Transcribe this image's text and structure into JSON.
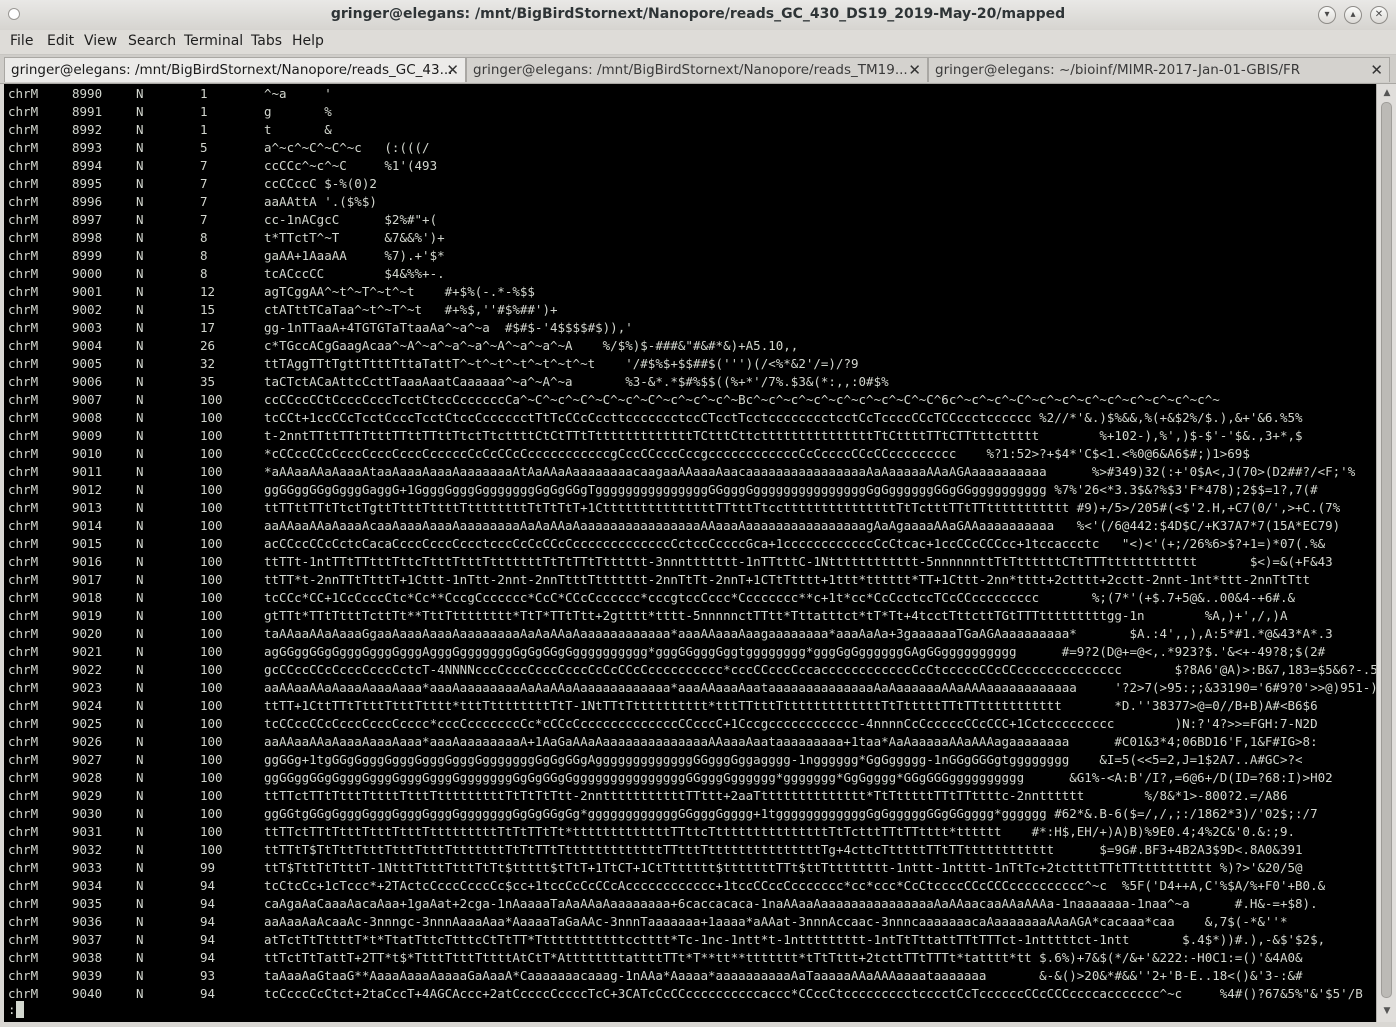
{
  "window": {
    "title": "gringer@elegans: /mnt/BigBirdStornext/Nanopore/reads_GC_430_DS19_2019-May-20/mapped"
  },
  "menu": [
    "File",
    "Edit",
    "View",
    "Search",
    "Terminal",
    "Tabs",
    "Help"
  ],
  "tabs": [
    {
      "label": "gringer@elegans: /mnt/BigBirdStornext/Nanopore/reads_GC_43...",
      "close": "✕"
    },
    {
      "label": "gringer@elegans: /mnt/BigBirdStornext/Nanopore/reads_TM19...",
      "close": "✕"
    },
    {
      "label": "gringer@elegans: ~/bioinf/MIMR-2017-Jan-01-GBIS/FR",
      "close": "✕"
    }
  ],
  "terminal": {
    "prompt": ":",
    "rows": [
      [
        "chrM",
        "8990",
        "N",
        "1",
        "^~a     '"
      ],
      [
        "chrM",
        "8991",
        "N",
        "1",
        "g       %"
      ],
      [
        "chrM",
        "8992",
        "N",
        "1",
        "t       &"
      ],
      [
        "chrM",
        "8993",
        "N",
        "5",
        "a^~c^~C^~C^~c   (:(((/"
      ],
      [
        "chrM",
        "8994",
        "N",
        "7",
        "ccCCc^~c^~C     %1'(493"
      ],
      [
        "chrM",
        "8995",
        "N",
        "7",
        "ccCCccC $-%(0)2"
      ],
      [
        "chrM",
        "8996",
        "N",
        "7",
        "aaAAttA '.($%$)"
      ],
      [
        "chrM",
        "8997",
        "N",
        "7",
        "cc-1nACgcC      $2%#\"+("
      ],
      [
        "chrM",
        "8998",
        "N",
        "8",
        "t*TTctT^~T      &7&&%')+"
      ],
      [
        "chrM",
        "8999",
        "N",
        "8",
        "gaAA+1AaaAA     %7).+'$*"
      ],
      [
        "chrM",
        "9000",
        "N",
        "8",
        "tcACccCC        $4&%%+-."
      ],
      [
        "chrM",
        "9001",
        "N",
        "12",
        "agTCggAA^~t^~T^~t^~t    #+$%(-.*-%$$"
      ],
      [
        "chrM",
        "9002",
        "N",
        "15",
        "ctATttTCaTaa^~t^~T^~t   #+%$,''#$%##')+"
      ],
      [
        "chrM",
        "9003",
        "N",
        "17",
        "gg-1nTTaaA+4TGTGTaTtaaAa^~a^~a  #$#$-'4$$$$#$)),'"
      ],
      [
        "chrM",
        "9004",
        "N",
        "26",
        "c*TGccACgGaagAcaa^~A^~a^~a^~a^~A^~a^~a^~A    %/$%)$-###&\"#&#*&)+A5.10,,"
      ],
      [
        "chrM",
        "9005",
        "N",
        "32",
        "ttTAggTTtTgttTtttTttaTattT^~t^~t^~t^~t^~t^~t    '/#$%$+$$##$(''')(/<%*&2'/=)/?9"
      ],
      [
        "chrM",
        "9006",
        "N",
        "35",
        "taCTctACaAttcCcttTaaaAaatCaaaaaa^~a^~A^~a       %3-&*.*$#%$$((%+*'/7%.$3&(*:,,:0#$%"
      ],
      [
        "chrM",
        "9007",
        "N",
        "100",
        "ccCCccCCtCcccCcccTcctCtccCccccccCa^~C^~c^~C^~C^~c^~C^~c^~c^~c^~Bc^~c^~c^~c^~c^~c^~c^~C^~C^6c^~c^~c^~C^~c^~c^~c^~c^~c^~c^~c^~c^~"
      ],
      [
        "chrM",
        "9008",
        "N",
        "100",
        "tcCCt+1ccCCcTcctCcccTcctCtccCcccccctTtTcCCcCccttccccccctccCTcctTcctcccccccctcctCcTccccCCcTCCccctcccccc %2//*'&.)$%&&,%(+&$2%/$.),&+'&6.%5%"
      ],
      [
        "chrM",
        "9009",
        "N",
        "100",
        "t-2nntTTttTTtTtttTTttTTttTtctTtcttttCtCtTTtTtttttttttttttTCtttCttctttttttttttttttTtCttttTTtCTTtttcttttt        %+102-),%',)$-$'-'$&.,3+*,$"
      ],
      [
        "chrM",
        "9010",
        "N",
        "100",
        "*cCCccCCcCcccCcccCcccCcccccCcCcCCcCcccccccccccgCccCCcccCccgccccccccccccCcCccccCCcCCccccccccc    %?1:52>?+$4*'C$<1.<%0@6&A6$#;)1>69$"
      ],
      [
        "chrM",
        "9011",
        "N",
        "100",
        "*aAAaaAAaAaaaAtaaAaaaAaaaAaaaaaaaAtAaAAaAaaaaaaaacaagaaAAaaaAaacaaaaaaaaaaaaaaaaAaAaaaaaAAaAGAaaaaaaaaaa      %>#349)32(:+'0$A<,J(70>(D2##?/<F;'%"
      ],
      [
        "chrM",
        "9012",
        "N",
        "100",
        "ggGGggGGgGgggGaggG+1GgggGgggGgggggggGgGgGGgTgggggggggggggggGGgggGgggggggggggggggGgGggggggGGgGGgggggggggg %7%'26<*3.3$&?%$3'F*478);2$$=1?,7(#"
      ],
      [
        "chrM",
        "9013",
        "N",
        "100",
        "ttTTttTTtTtctTgttTtttTttttTttttttttTtTtTtT+1CtttttttttttttttTTtttTtcctttttttttttttttTtTctttTTtTTttttttttttt #9)+/5>/205#(<$'2.H,+C7(0/',>+C.(7%"
      ],
      [
        "chrM",
        "9014",
        "N",
        "100",
        "aaAAaaAAaAaaaAcaaAaaaAaaaAaaaaaaaaAaAaAAaAaaaaaaaaaaaaaaaaAAaaaAaaaaaaaaaaaaaaaagAaAgaaaaAAaGAAaaaaaaaaaa   %<'(/6@442:$4D$C/+K37A7*7(15A*EC79)"
      ],
      [
        "chrM",
        "9015",
        "N",
        "100",
        "acCCccCCcCctcCacaCcccCcccCccctcccCcCcCCcCcccccccccccccCctccCccccGca+1ccccccccccccCcCtcac+1ccCCcCCCcc+1tccaccctc   \"<)<'(+;/26%6>$?+1=)*07(.%&"
      ],
      [
        "chrM",
        "9016",
        "N",
        "100",
        "ttTTt-1ntTTtTTtttTttcTtttTtttTtttttttTtTtTTtTtttttt-3nnnttttttt-1nTTtttC-1Ntttttttttttt-5nnnnnnttTtTttttttCTtTTTtttttttttttt       $<)=&(+F&43"
      ],
      [
        "chrM",
        "9017",
        "N",
        "100",
        "ttTT*t-2nnTTtTtttT+1Cttt-1nTtt-2nnt-2nnTtttTttttttt-2nnTtTt-2nnT+1CTtTtttt+1ttt*tttttt*TT+1Cttt-2nn*tttt+2ctttt+2cctt-2nnt-1nt*ttt-2nnTtTtt"
      ],
      [
        "chrM",
        "9018",
        "N",
        "100",
        "tcCCc*CC+1CcCcccCtc*Cc**CccgCcccccc*CcC*CCcCcccccc*cccgtccCccc*Cccccccc**c+1t*cc*CcCcctccTCcCCccccccccc       %;(7*'(+$.7+5@&..00&4-+6#.&"
      ],
      [
        "chrM",
        "9019",
        "N",
        "100",
        "gtTTt*TTtTtttTcttTt**TttTtttttttt*TtT*TTtTtt+2gtttt*tttt-5nnnnnctTTtt*Tttatttct*tT*Tt+4tcctTttcttTGtTTTtttttttttgg-1n        %A,)+',/,)A"
      ],
      [
        "chrM",
        "9020",
        "N",
        "100",
        "taAAaaAAaAaaaGgaaAaaaAaaaAaaaaaaaaAaAaAAaAaaaaaaaaaaaa*aaaAAaaaAaagaaaaaaaa*aaaAaAa+3gaaaaaaTGaAGAaaaaaaaaa*       $A.:4',,),A:5*#1.*@&43*A*.3"
      ],
      [
        "chrM",
        "9021",
        "N",
        "100",
        "agGGggGGgGgggGgggGgggAgggGgggggggGgGgGGgGgggggggggg*gggGGgggGggtgggggggg*gggGgGggggggGAgGGgggggggggg      #=9?2(D@+=@<,.*923?$.'&<+-49?8;$(2#"
      ],
      [
        "chrM",
        "9022",
        "N",
        "100",
        "gcCCccCCcCcccCcccCctcT-4NNNNcccCcccCcccCcccCcCcCCcCcccccccccc*cccCCcccCccaccccccccccccCcCtcccccCCcCCcccccccccccccc       $?8A6'@A)>:B&7,183=$5&6?-.5"
      ],
      [
        "chrM",
        "9023",
        "N",
        "100",
        "aaAAaaAAaAaaaAaaaAaaa*aaaAaaaaaaaaAaAaAAaAaaaaaaaaaaaa*aaaAAaaaAaataaaaaaaaaaaaaaAaAaaaaaaAAaAAAaaaaaaaaaaaa     '?2>7(>95:;;&33190='6#9?0'>>@)951-)"
      ],
      [
        "chrM",
        "9024",
        "N",
        "100",
        "ttTT+1CttTTtTtttTtttTtttt*tttTttttttttTtT-1NtTTtTtttttttttt*tttTTtttTtttttttttttttTtTtttttTTtTTttttttttttt       *D.''38377>@=0//B+B)A#<B6$6"
      ],
      [
        "chrM",
        "9025",
        "N",
        "100",
        "tcCCccCCcCcccCcccCcccc*cccCcccccccCc*cCCcCcccccccccccccCCcccC+1Cccgcccccccccccc-4nnnnCcCcccccCCcCCC+1Cctccccccccc        )N:?'4?>>=FGH:7-N2D"
      ],
      [
        "chrM",
        "9026",
        "N",
        "100",
        "aaAAaaAAaAaaaAaaaAaaa*aaaAaaaaaaaaA+1AaGaAAaAaaaaaaaaaaaaaaAAaaaAaataaaaaaaaa+1taa*AaAaaaaaAAaAAAagaaaaaaaa      #C01&3*4;06BD16'F,1&F#IG>8:"
      ],
      [
        "chrM",
        "9027",
        "N",
        "100",
        "ggGGg+1tgGGgGgggGgggGgggGgggGgggggggGgGgGGgAgggggggggggggGGgggGggagggg-1ngggggg*GgGggggg-1nGGgGGGgtgggggggg    &I=5(<<5=2,J=1$2A7..A#GC>?<"
      ],
      [
        "chrM",
        "9028",
        "N",
        "100",
        "ggGGggGGgGgggGgggGgggGgggGgggggggGgGgGGgGgggggggggggggggGGgggGgggggg*ggggggg*GgGgggg*GGgGGGgggggggggg      &G1%-<A:B'/I?,=6@6+/D(ID=?68:I)>H02"
      ],
      [
        "chrM",
        "9029",
        "N",
        "100",
        "ttTTctTTtTtttTttttTtttTtttttttttTtTtTtTtt-2nntttttttttttTTttt+2aaTtttttttttttttt*TtTtttttTTtTTttttc-2nntttttt        %/8&*1>-800?2.=/A86"
      ],
      [
        "chrM",
        "9030",
        "N",
        "100",
        "ggGGtgGGgGgggGgggGgggGgggGgggggggGgGgGGgGg*ggggggggggggGGgggGgggg+1tggggggggggggGgGgggggGGgGGgggg*gggggg #62*&.B-6($=/,/,;:/1862*3)/'02$;:/7"
      ],
      [
        "chrM",
        "9031",
        "N",
        "100",
        "ttTTctTTtTtttTtttTtttTtttttttttTtTtTTtTt*tttttttttttttTTttcTtttttttttttttttTtTctttTTtTTtttt*tttttt    #*:H$,EH/+)A)B)%9E0.4;4%2C&'0.&:;9."
      ],
      [
        "chrM",
        "9032",
        "N",
        "100",
        "ttTTtT$TtTttTtttTtttTtttTtttttttTtTtTTtTtttttttttttttTTtttTtttttttttttttttTg+4cttcTtttttTTtTTtttttttttttt      $=9G#.BF3+4B2A3$9D<.8A0&391"
      ],
      [
        "chrM",
        "9033",
        "N",
        "99",
        "ttT$TttTtTtttT-1NtttTtttTtttTtTt$ttttt$tTtT+1TtCT+1CtTtttttt$tttttttTTt$ttTtttttttt-1nttt-1ntttt-1nTtTc+2tcttttTTtTTtttttttttt %)?>'&20/5@"
      ],
      [
        "chrM",
        "9034",
        "N",
        "94",
        "tcCtcCc+1cTccc*+2TActcCcccCcccCc$cc+1tccCcCcCCcAcccccccccccc+1tccCCccCccccccc*cc*ccc*CcCtccccCCcCCCcccccccccc^~c  %5F('D4++A,C'%$A/%+F0'+B0.&"
      ],
      [
        "chrM",
        "9035",
        "N",
        "94",
        "caAgaAaCaaaAacaAaa+1gaAat+2cga-1nAaaaaTaAaAAaAaaaaaaaa+6caccacaca-1naAAaaAaaaaaaaaaaaaaaaAaAAaacaaAAaAAAa-1naaaaaaa-1naa^~a      #.H&-=+$8)."
      ],
      [
        "chrM",
        "9036",
        "N",
        "94",
        "aaAaaAaAcaaAc-3nnngc-3nnnAaaaAaa*AaaaaTaGaAAc-3nnnTaaaaaaa+1aaaa*aAAat-3nnnAccaac-3nnncaaaaaaacaAaaaaaaaAAaAGA*cacaaa*caa    &,7$(-*&''*"
      ],
      [
        "chrM",
        "9037",
        "N",
        "94",
        "atTctTtTttttT*t*TtatTttcTtttcCtTtTT*Ttttttttttttcctttt*Tc-1nc-1ntt*t-1nttttttttt-1ntTtTttattTTtTTTct-1ntttttct-1ntt       $.4$*))#.),-&$'$2$,"
      ],
      [
        "chrM",
        "9038",
        "N",
        "94",
        "ttTctTtTattT+2TT*t$*TtttTtttTttttAtCtT*AttttttttattttTTt*T**tt**ttttttt*tTtTttt+2tcttTTtTTTt*tatttt*tt $.6%)+7&$(*/&+'&222:-H0C1:=()'&4A0&"
      ],
      [
        "chrM",
        "9039",
        "N",
        "93",
        "taAaaAaGtaaG**AaaaAaaaAaaaaGaAaaA*Caaaaaaacaaag-1nAAa*Aaaaa*aaaaaaaaaaAaTaaaaaAAaAAAaaaataaaaaaa       &-&()>20&*#&&''2+'B-E..18<()&'3-:&#"
      ],
      [
        "chrM",
        "9040",
        "N",
        "94",
        "tcCcccCcCtct+2taCccT+4AGCAccc+2atCccccCccccTcC+3CATcCcCCccccccccccaccc*CCccCtccccccccctcccctCcTccccccCCcCCCccccaccccccc^~c     %4#()?67&5%\"&'$5'/B"
      ]
    ]
  }
}
